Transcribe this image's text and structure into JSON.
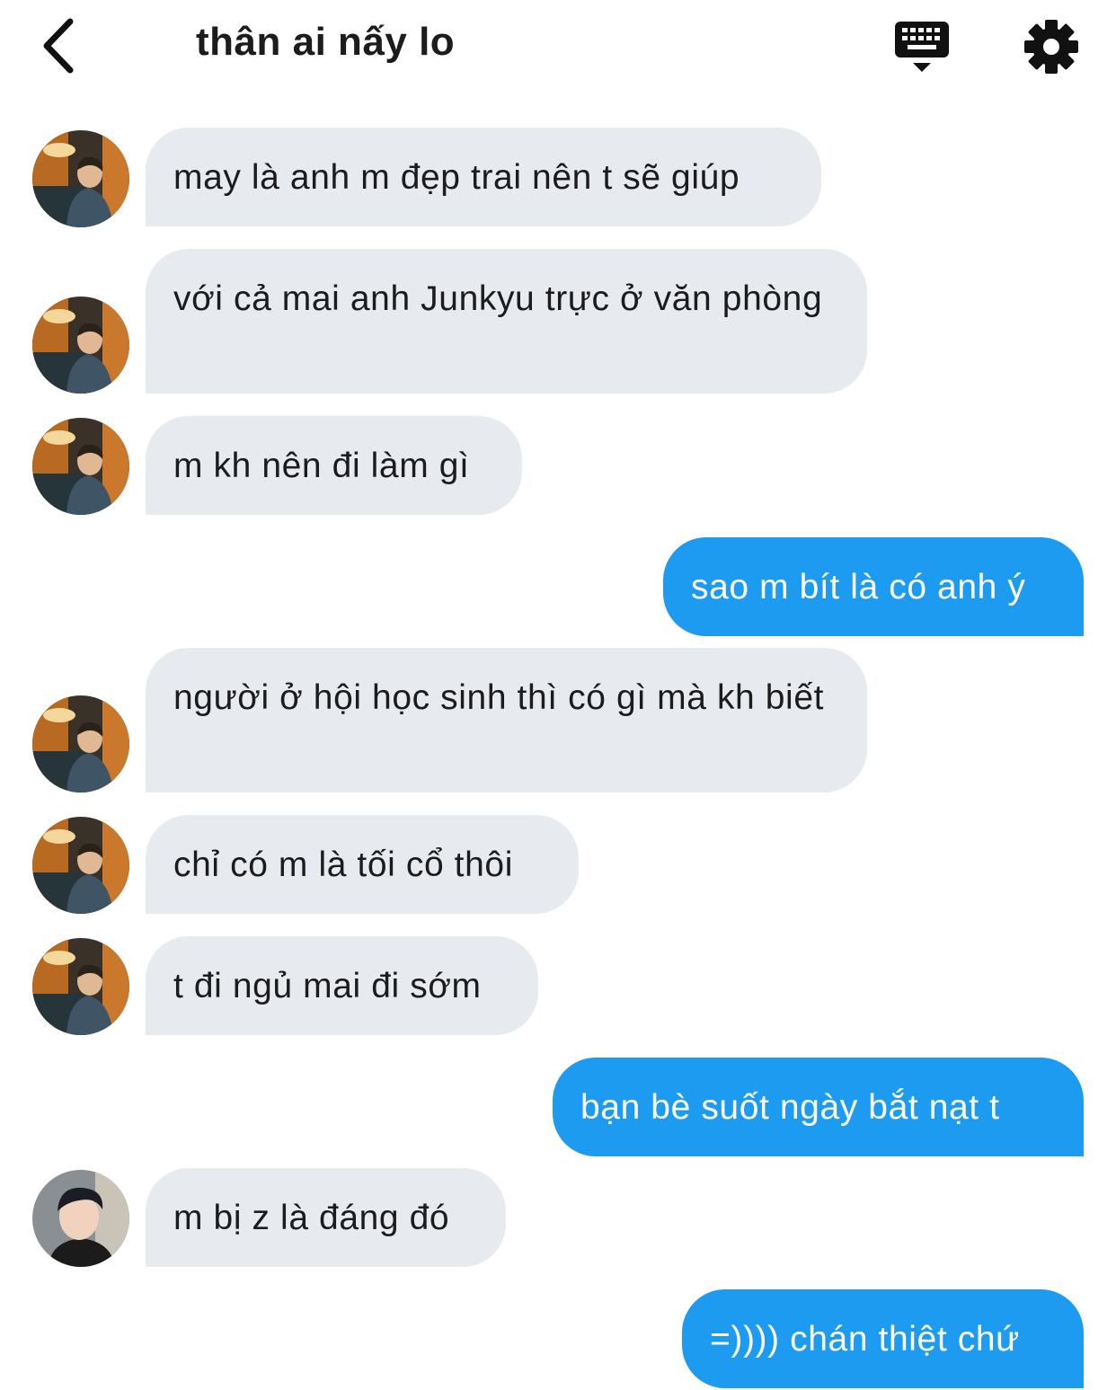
{
  "header": {
    "title": "thân ai nấy lo",
    "back_icon": "chevron-left-icon",
    "keyboard_icon": "keyboard-icon",
    "settings_icon": "gear-icon"
  },
  "colors": {
    "incoming_bubble": "#e7ebef",
    "outgoing_bubble": "#1d9bf0",
    "text": "#1c1c1e"
  },
  "messages": [
    {
      "direction": "in",
      "text": "may là anh m đẹp trai nên t sẽ giúp",
      "avatar": "avatar-a"
    },
    {
      "direction": "in",
      "text": "với cả mai anh Junkyu trực ở văn phòng",
      "avatar": "avatar-a"
    },
    {
      "direction": "in",
      "text": "m kh nên đi làm gì",
      "avatar": "avatar-a"
    },
    {
      "direction": "out",
      "text": "sao m bít là có anh ý"
    },
    {
      "direction": "in",
      "text": "người ở hội học sinh thì có gì mà kh biết",
      "avatar": "avatar-a"
    },
    {
      "direction": "in",
      "text": "chỉ có m là tối cổ thôi",
      "avatar": "avatar-a"
    },
    {
      "direction": "in",
      "text": "t đi ngủ mai đi sớm",
      "avatar": "avatar-a"
    },
    {
      "direction": "out",
      "text": "bạn bè suốt ngày bắt nạt t"
    },
    {
      "direction": "in",
      "text": "m bị z là đáng đó",
      "avatar": "avatar-b"
    },
    {
      "direction": "out",
      "text": "=)))) chán thiệt chứ"
    }
  ]
}
